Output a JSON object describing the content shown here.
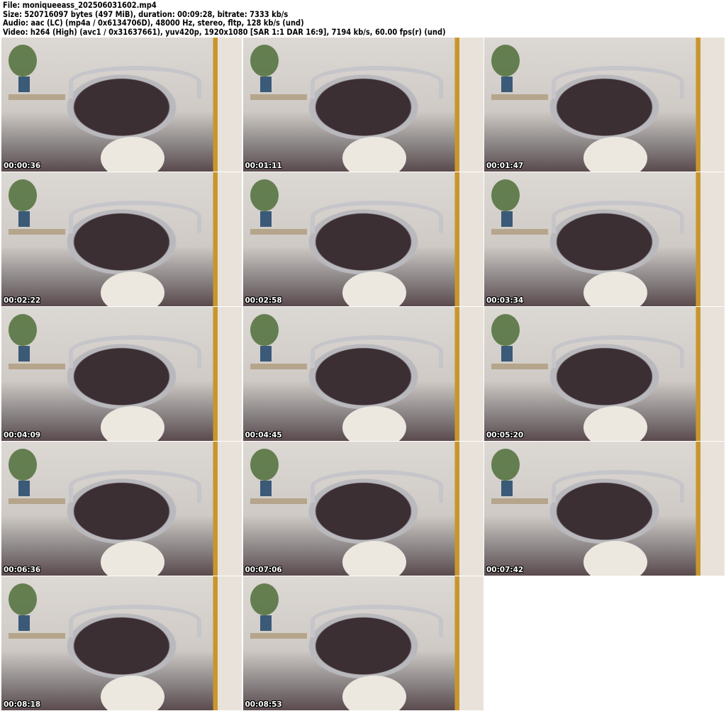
{
  "header": {
    "file": "File: moniqueeass_202506031602.mp4",
    "size": "Size: 520716097 bytes (497 MiB), duration: 00:09:28, bitrate: 7333 kb/s",
    "audio": "Audio: aac (LC) (mp4a / 0x6134706D), 48000 Hz, stereo, fltp, 128 kb/s (und)",
    "video": "Video: h264 (High) (avc1 / 0x31637661), yuv420p, 1920x1080 [SAR 1:1 DAR 16:9], 7194 kb/s, 60.00 fps(r) (und)"
  },
  "thumbnails": [
    {
      "timestamp": "00:00:36"
    },
    {
      "timestamp": "00:01:11"
    },
    {
      "timestamp": "00:01:47"
    },
    {
      "timestamp": "00:02:22"
    },
    {
      "timestamp": "00:02:58"
    },
    {
      "timestamp": "00:03:34"
    },
    {
      "timestamp": "00:04:09"
    },
    {
      "timestamp": "00:04:45"
    },
    {
      "timestamp": "00:05:20"
    },
    {
      "timestamp": "00:06:36"
    },
    {
      "timestamp": "00:07:06"
    },
    {
      "timestamp": "00:07:42"
    },
    {
      "timestamp": "00:08:18"
    },
    {
      "timestamp": "00:08:53"
    }
  ]
}
